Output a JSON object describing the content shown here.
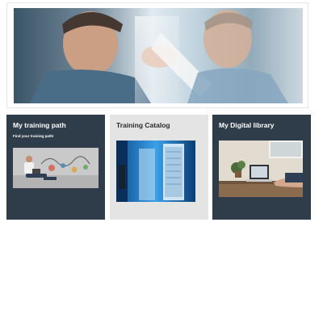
{
  "tiles": [
    {
      "title": "My training path",
      "subtitle": "Find your training path!",
      "background": "#2f3d4a"
    },
    {
      "title": "Training Catalog",
      "subtitle": "",
      "background": "#e4e4e4"
    },
    {
      "title": "My Digital library",
      "subtitle": "",
      "background": "#2f3d4a"
    }
  ],
  "colors": {
    "tile_dark": "#2f3d4a",
    "tile_light": "#e4e4e4",
    "text_light": "#ffffff",
    "text_dark": "#2b2b2b"
  }
}
